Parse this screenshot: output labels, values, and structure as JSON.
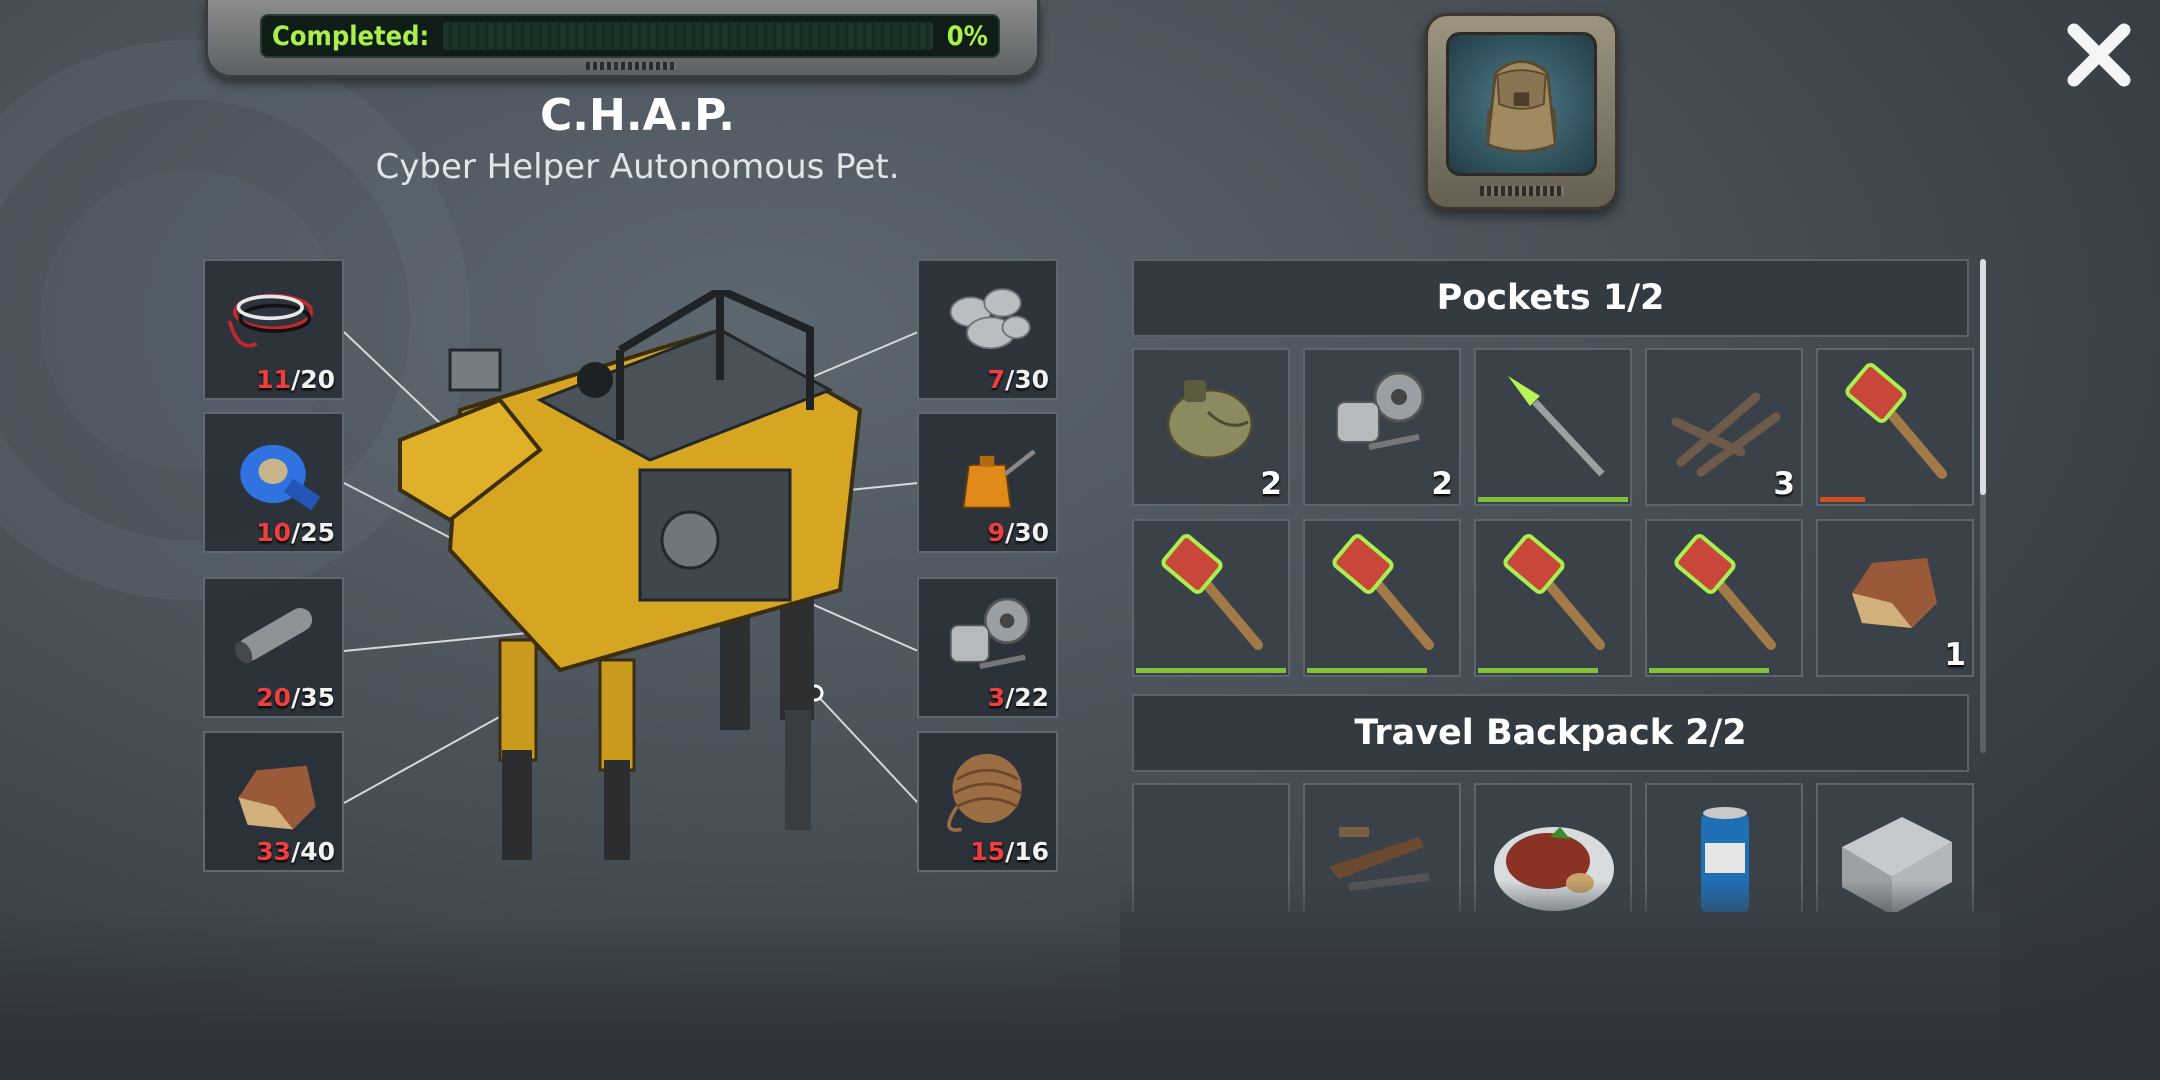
{
  "progress": {
    "label": "Completed:",
    "value_text": "0%",
    "value": 0
  },
  "blueprint": {
    "title": "C.H.A.P.",
    "subtitle": "Cyber Helper Autonomous Pet."
  },
  "backpack_icon": "backpack-icon",
  "close_icon": "close-icon",
  "materials_left": [
    {
      "icon": "wires-icon",
      "have": "11",
      "need": "/20"
    },
    {
      "icon": "duct-tape-icon",
      "have": "10",
      "need": "/25"
    },
    {
      "icon": "pipe-icon",
      "have": "20",
      "need": "/35"
    },
    {
      "icon": "leather-icon",
      "have": "33",
      "need": "/40"
    }
  ],
  "materials_right": [
    {
      "icon": "metal-ore-icon",
      "have": "7",
      "need": "/30"
    },
    {
      "icon": "oil-can-icon",
      "have": "9",
      "need": "/30"
    },
    {
      "icon": "engine-parts-icon",
      "have": "3",
      "need": "/22"
    },
    {
      "icon": "rope-icon",
      "have": "15",
      "need": "/16"
    }
  ],
  "inventory": {
    "pockets": {
      "title": "Pockets  1/2",
      "items": [
        {
          "icon": "flask-icon",
          "count": "2"
        },
        {
          "icon": "engine-parts-icon",
          "count": "2"
        },
        {
          "icon": "spear-icon",
          "count": "",
          "durability": 1.0
        },
        {
          "icon": "rebar-icon",
          "count": "3"
        },
        {
          "icon": "sledgehammer-icon",
          "count": "",
          "durability": 0.3
        },
        {
          "icon": "sledgehammer-icon",
          "count": "",
          "durability": 1.0
        },
        {
          "icon": "sledgehammer-icon",
          "count": "",
          "durability": 0.8
        },
        {
          "icon": "sledgehammer-icon",
          "count": "",
          "durability": 0.8
        },
        {
          "icon": "sledgehammer-icon",
          "count": "",
          "durability": 0.8
        },
        {
          "icon": "leather-icon",
          "count": "1"
        }
      ]
    },
    "backpack": {
      "title": "Travel Backpack  2/2",
      "items": [
        {
          "icon": "empty-slot",
          "count": ""
        },
        {
          "icon": "weapon-parts-icon",
          "count": ""
        },
        {
          "icon": "steak-icon",
          "count": ""
        },
        {
          "icon": "soda-can-icon",
          "count": ""
        },
        {
          "icon": "concrete-block-icon",
          "count": ""
        }
      ]
    }
  },
  "colors": {
    "accent_green": "#a9f04e",
    "missing_red": "#ef3e3e"
  }
}
